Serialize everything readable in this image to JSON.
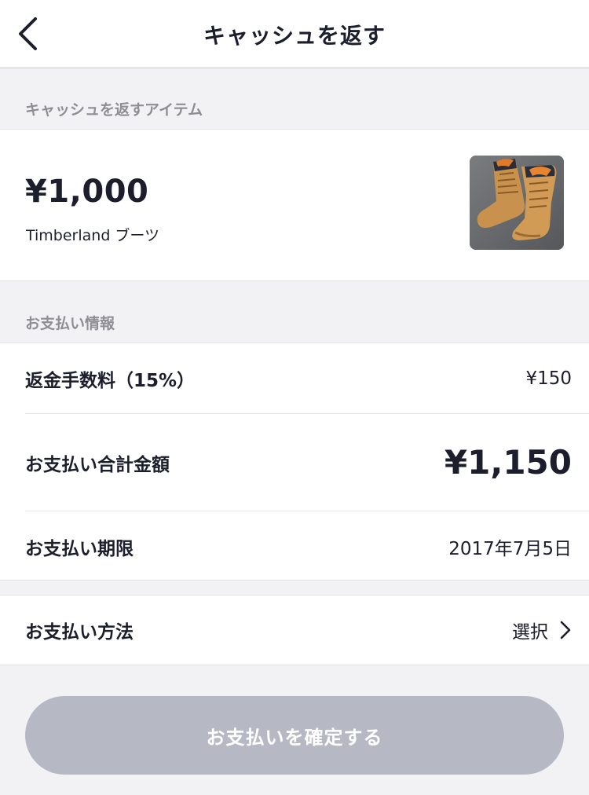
{
  "header": {
    "title": "キャッシュを返す",
    "back_icon": "chevron-left-icon"
  },
  "item_section": {
    "heading": "キャッシュを返すアイテム",
    "price": "¥1,000",
    "name": "Timberland ブーツ",
    "thumbnail_icon": "boots-photo"
  },
  "payment_section": {
    "heading": "お支払い情報",
    "fee_label": "返金手数料（15%）",
    "fee_value": "¥150",
    "total_label": "お支払い合計金額",
    "total_value": "¥1,150",
    "deadline_label": "お支払い期限",
    "deadline_value": "2017年7月5日"
  },
  "method_section": {
    "label": "お支払い方法",
    "value": "選択",
    "chevron_icon": "chevron-right-icon"
  },
  "confirm_button": {
    "label": "お支払いを確定する"
  },
  "colors": {
    "background": "#f2f2f4",
    "text": "#1c1e2e",
    "muted": "#8e8e94",
    "button_disabled": "#b6b9c4"
  }
}
